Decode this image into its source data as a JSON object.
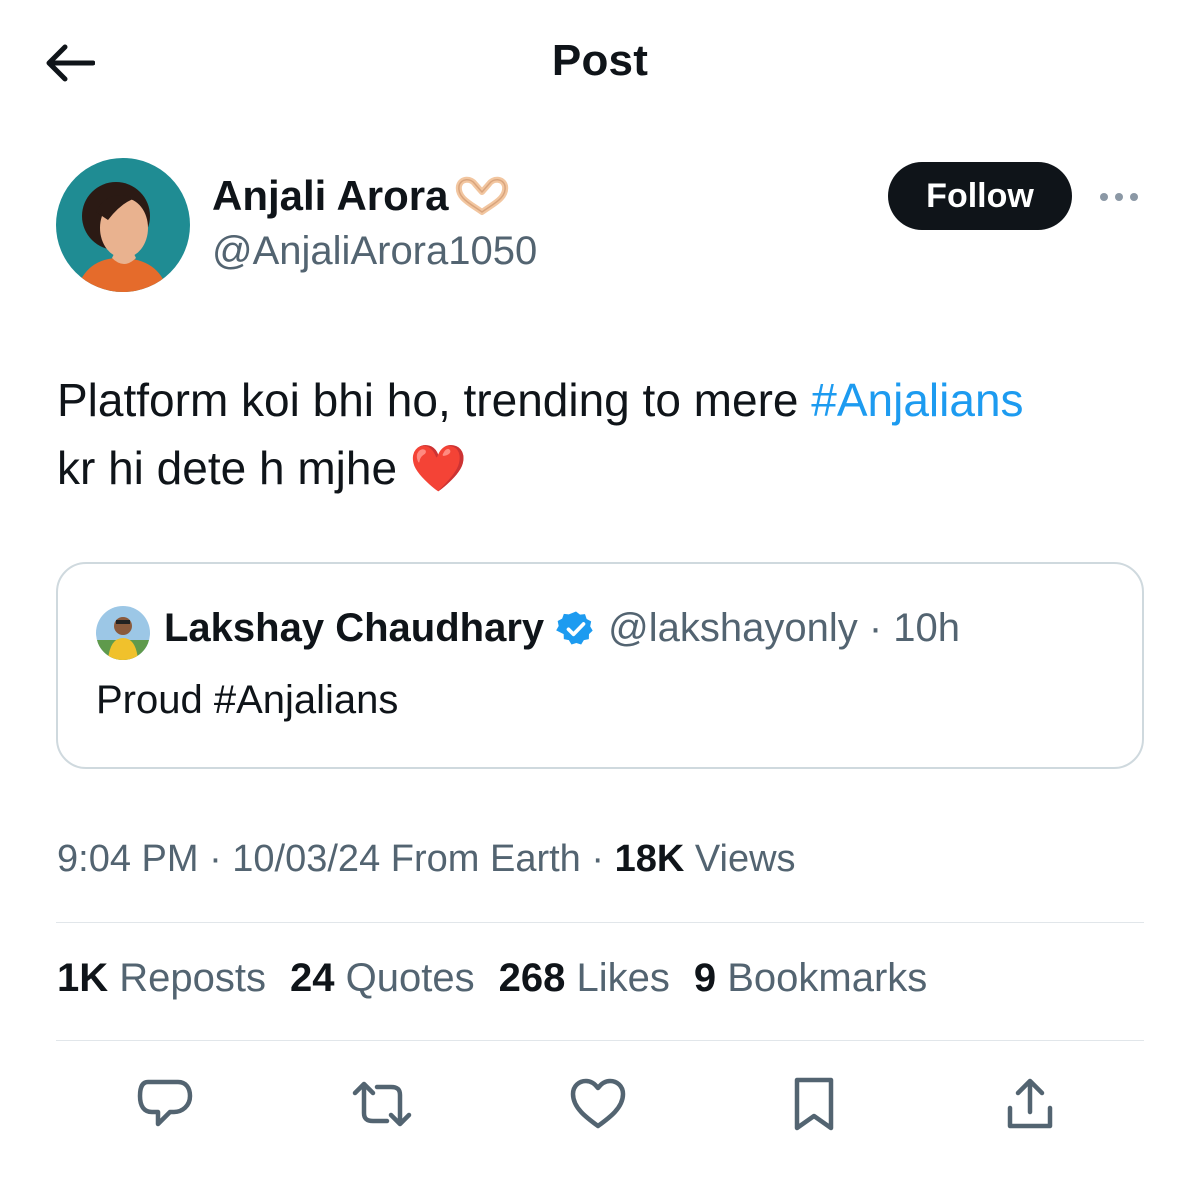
{
  "header": {
    "title": "Post"
  },
  "author": {
    "display_name": "Anjali Arora",
    "handle": "@AnjaliArora1050",
    "follow_label": "Follow"
  },
  "tweet": {
    "text_before": "Platform koi bhi ho, trending to mere ",
    "hashtag": "#Anjalians",
    "text_after": " kr hi dete h mjhe",
    "emoji": "❤️"
  },
  "quote": {
    "name": "Lakshay Chaudhary",
    "handle_time": "@lakshayonly · 10h",
    "text": "Proud #Anjalians"
  },
  "meta": {
    "time_date": "9:04 PM · 10/03/24 From Earth · ",
    "views_count": "18K",
    "views_label": " Views"
  },
  "stats": {
    "reposts_count": "1K",
    "reposts_label": "Reposts",
    "quotes_count": "24",
    "quotes_label": "Quotes",
    "likes_count": "268",
    "likes_label": "Likes",
    "bookmarks_count": "9",
    "bookmarks_label": "Bookmarks"
  },
  "icons": [
    "back-arrow-icon",
    "heart-hands-emoji-icon",
    "more-dots-icon",
    "verified-badge-icon",
    "reply-icon",
    "repost-icon",
    "like-icon",
    "bookmark-icon",
    "share-icon"
  ],
  "colors": {
    "link": "#1d9bf0",
    "secondary_text": "#536471",
    "verified": "#1d9bf0",
    "follow_bg": "#0f1419"
  }
}
